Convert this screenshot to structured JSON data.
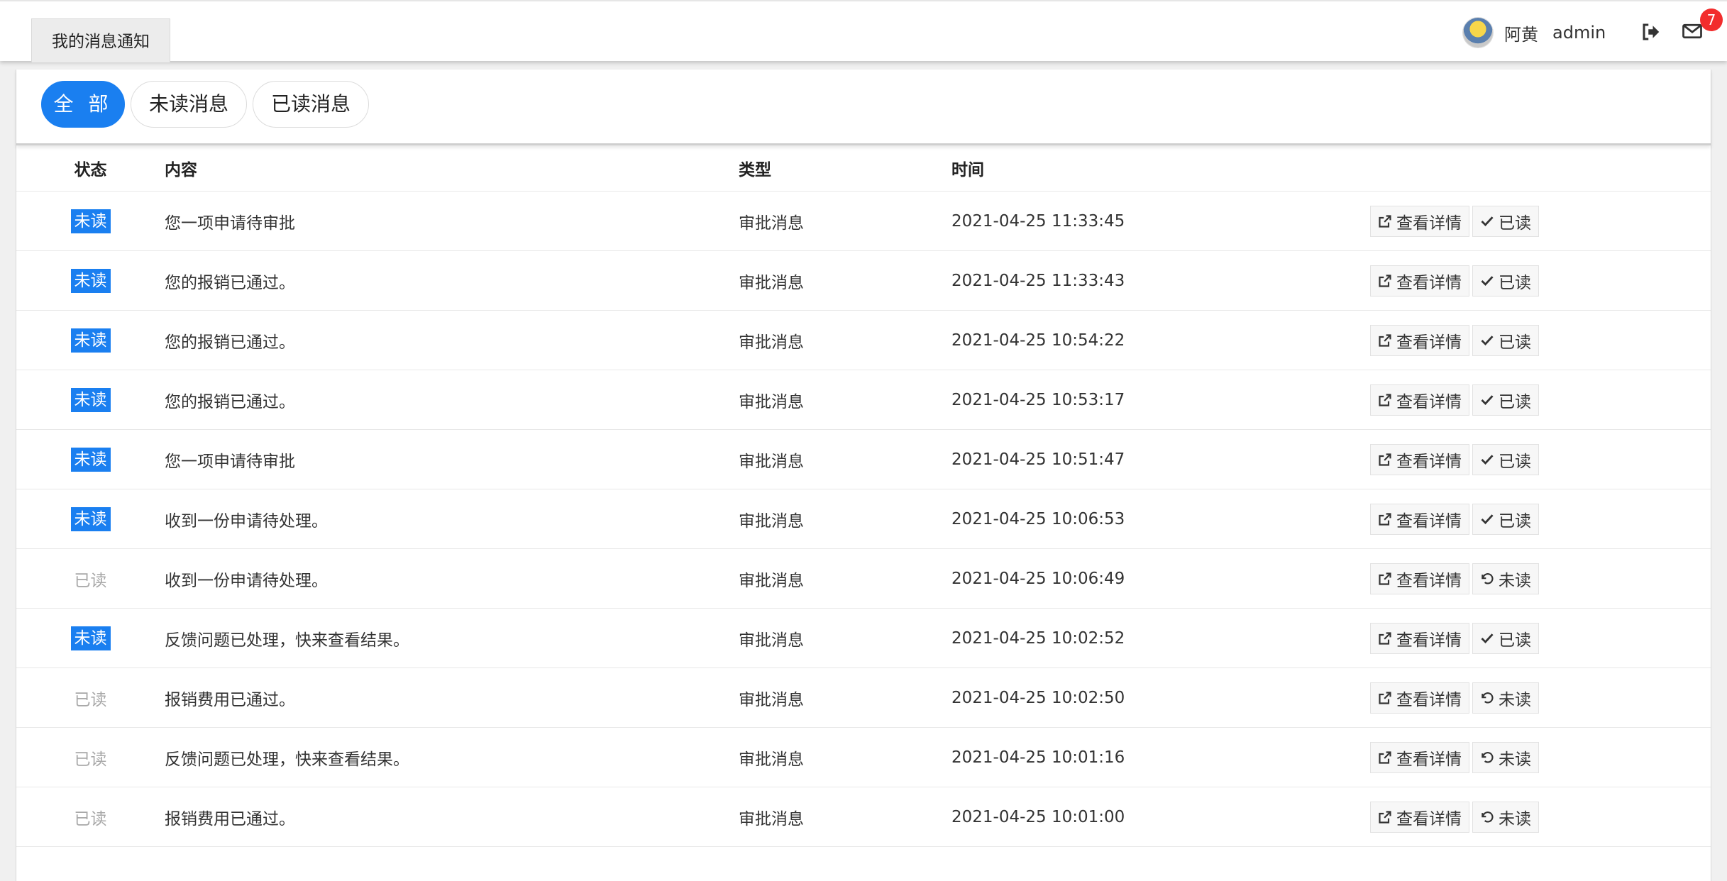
{
  "header": {
    "page_tab": "我的消息通知",
    "user_name": "阿黄",
    "user_account": "admin",
    "unread_count": "7",
    "icons": [
      "avatar",
      "logout-icon",
      "mail-icon"
    ]
  },
  "filters": [
    {
      "label": "全 部",
      "active": true
    },
    {
      "label": "未读消息",
      "active": false
    },
    {
      "label": "已读消息",
      "active": false
    }
  ],
  "table": {
    "columns": [
      "状态",
      "内容",
      "类型",
      "时间",
      ""
    ],
    "detail_label": "查看详情",
    "rows": [
      {
        "status": "未读",
        "content": "您一项申请待审批",
        "type": "审批消息",
        "time": "2021-04-25 11:33:45",
        "toggle": "已读"
      },
      {
        "status": "未读",
        "content": "您的报销已通过。",
        "type": "审批消息",
        "time": "2021-04-25 11:33:43",
        "toggle": "已读"
      },
      {
        "status": "未读",
        "content": "您的报销已通过。",
        "type": "审批消息",
        "time": "2021-04-25 10:54:22",
        "toggle": "已读"
      },
      {
        "status": "未读",
        "content": "您的报销已通过。",
        "type": "审批消息",
        "time": "2021-04-25 10:53:17",
        "toggle": "已读"
      },
      {
        "status": "未读",
        "content": "您一项申请待审批",
        "type": "审批消息",
        "time": "2021-04-25 10:51:47",
        "toggle": "已读"
      },
      {
        "status": "未读",
        "content": "收到一份申请待处理。",
        "type": "审批消息",
        "time": "2021-04-25 10:06:53",
        "toggle": "已读"
      },
      {
        "status": "已读",
        "content": "收到一份申请待处理。",
        "type": "审批消息",
        "time": "2021-04-25 10:06:49",
        "toggle": "未读"
      },
      {
        "status": "未读",
        "content": "反馈问题已处理，快来查看结果。",
        "type": "审批消息",
        "time": "2021-04-25 10:02:52",
        "toggle": "已读"
      },
      {
        "status": "已读",
        "content": "报销费用已通过。",
        "type": "审批消息",
        "time": "2021-04-25 10:02:50",
        "toggle": "未读"
      },
      {
        "status": "已读",
        "content": "反馈问题已处理，快来查看结果。",
        "type": "审批消息",
        "time": "2021-04-25 10:01:16",
        "toggle": "未读"
      },
      {
        "status": "已读",
        "content": "报销费用已通过。",
        "type": "审批消息",
        "time": "2021-04-25 10:01:00",
        "toggle": "未读"
      }
    ]
  },
  "colors": {
    "accent": "#1a7ff0",
    "badge_red": "#f22c2c",
    "read_text": "#a8a8a8"
  }
}
